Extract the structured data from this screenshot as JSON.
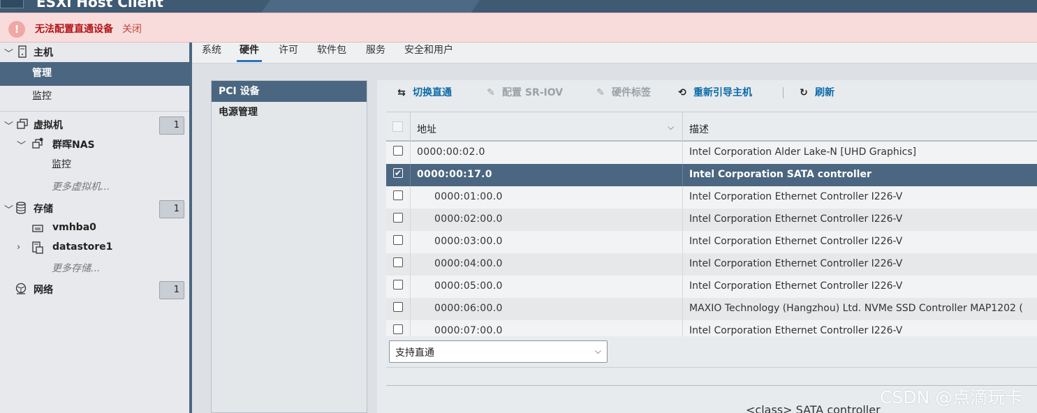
{
  "header": {
    "app_title": "ESXi Host Client"
  },
  "alert": {
    "icon": "!",
    "message": "无法配置直通设备",
    "close": "关闭"
  },
  "nav": {
    "host": {
      "label": "主机",
      "icon": "server-icon"
    },
    "manage": "管理",
    "monitor": "监控",
    "vms": {
      "label": "虚拟机",
      "count": "1"
    },
    "vm_nas": {
      "label": "群晖NAS"
    },
    "vm_monitor": "监控",
    "more_vms": "更多虚拟机...",
    "storage": {
      "label": "存储",
      "count": "1"
    },
    "vmhba": "vmhba0",
    "datastore": "datastore1",
    "more_storage": "更多存储...",
    "network": {
      "label": "网络",
      "count": "1"
    }
  },
  "tabs": [
    "系统",
    "硬件",
    "许可",
    "软件包",
    "服务",
    "安全和用户"
  ],
  "subnav": [
    "PCI 设备",
    "电源管理"
  ],
  "toolbar": {
    "toggle": "切换直通",
    "sriov": "配置 SR-IOV",
    "label": "硬件标签",
    "reboot": "重新引导主机",
    "refresh": "刷新"
  },
  "grid": {
    "col_address": "地址",
    "col_desc": "描述",
    "rows": [
      {
        "address": "0000:00:02.0",
        "desc": "Intel Corporation Alder Lake-N [UHD Graphics]",
        "checked": false
      },
      {
        "address": "0000:00:17.0",
        "desc": "Intel Corporation SATA controller",
        "checked": true
      },
      {
        "address": "0000:01:00.0",
        "desc": "Intel Corporation Ethernet Controller I226-V",
        "checked": false
      },
      {
        "address": "0000:02:00.0",
        "desc": "Intel Corporation Ethernet Controller I226-V",
        "checked": false
      },
      {
        "address": "0000:03:00.0",
        "desc": "Intel Corporation Ethernet Controller I226-V",
        "checked": false
      },
      {
        "address": "0000:04:00.0",
        "desc": "Intel Corporation Ethernet Controller I226-V",
        "checked": false
      },
      {
        "address": "0000:05:00.0",
        "desc": "Intel Corporation Ethernet Controller I226-V",
        "checked": false
      },
      {
        "address": "0000:06:00.0",
        "desc": "MAXIO Technology (Hangzhou) Ltd. NVMe SSD Controller MAP1202 (",
        "checked": false
      },
      {
        "address": "0000:07:00.0",
        "desc": "Intel Corporation Ethernet Controller I226-V",
        "checked": false
      }
    ]
  },
  "filter": {
    "value": "支持直通"
  },
  "detail": "<class> SATA controller",
  "watermark": "CSDN @点滴玩卡"
}
